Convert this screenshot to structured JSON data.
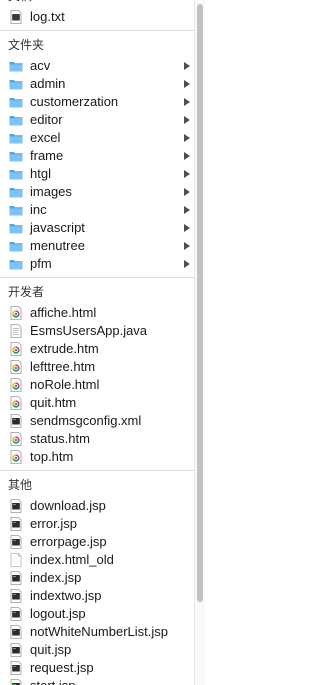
{
  "groups": {
    "documents": {
      "header": "文稿",
      "items": [
        {
          "name": "log.txt",
          "icon": "text-file-icon"
        }
      ]
    },
    "folders": {
      "header": "文件夹",
      "items": [
        {
          "name": "acv"
        },
        {
          "name": "admin"
        },
        {
          "name": "customerzation"
        },
        {
          "name": "editor"
        },
        {
          "name": "excel"
        },
        {
          "name": "frame"
        },
        {
          "name": "htgl"
        },
        {
          "name": "images"
        },
        {
          "name": "inc"
        },
        {
          "name": "javascript"
        },
        {
          "name": "menutree"
        },
        {
          "name": "pfm"
        }
      ]
    },
    "developer": {
      "header": "开发者",
      "items": [
        {
          "name": "affiche.html",
          "icon": "chrome-html-icon"
        },
        {
          "name": "EsmsUsersApp.java",
          "icon": "java-file-icon"
        },
        {
          "name": "extrude.htm",
          "icon": "chrome-html-icon"
        },
        {
          "name": "lefttree.htm",
          "icon": "chrome-html-icon"
        },
        {
          "name": "noRole.html",
          "icon": "chrome-html-icon"
        },
        {
          "name": "quit.htm",
          "icon": "chrome-html-icon"
        },
        {
          "name": "sendmsgconfig.xml",
          "icon": "exec-file-icon"
        },
        {
          "name": "status.htm",
          "icon": "chrome-html-icon"
        },
        {
          "name": "top.htm",
          "icon": "chrome-html-icon"
        }
      ]
    },
    "other": {
      "header": "其他",
      "items": [
        {
          "name": "download.jsp",
          "icon": "exec-file-icon"
        },
        {
          "name": "error.jsp",
          "icon": "exec-file-icon"
        },
        {
          "name": "errorpage.jsp",
          "icon": "exec-file-icon"
        },
        {
          "name": "index.html_old",
          "icon": "blank-file-icon"
        },
        {
          "name": "index.jsp",
          "icon": "exec-file-icon"
        },
        {
          "name": "indextwo.jsp",
          "icon": "exec-file-icon"
        },
        {
          "name": "logout.jsp",
          "icon": "exec-file-icon"
        },
        {
          "name": "notWhiteNumberList.jsp",
          "icon": "exec-file-icon"
        },
        {
          "name": "quit.jsp",
          "icon": "exec-file-icon"
        },
        {
          "name": "request.jsp",
          "icon": "exec-file-icon"
        },
        {
          "name": "start.jsp",
          "icon": "exec-file-icon"
        }
      ]
    }
  },
  "colors": {
    "folder": "#4aa8e8",
    "folder_tab": "#7cc2f2",
    "divider": "#dcdcdc",
    "scroll_thumb": "#c2c2c2"
  }
}
